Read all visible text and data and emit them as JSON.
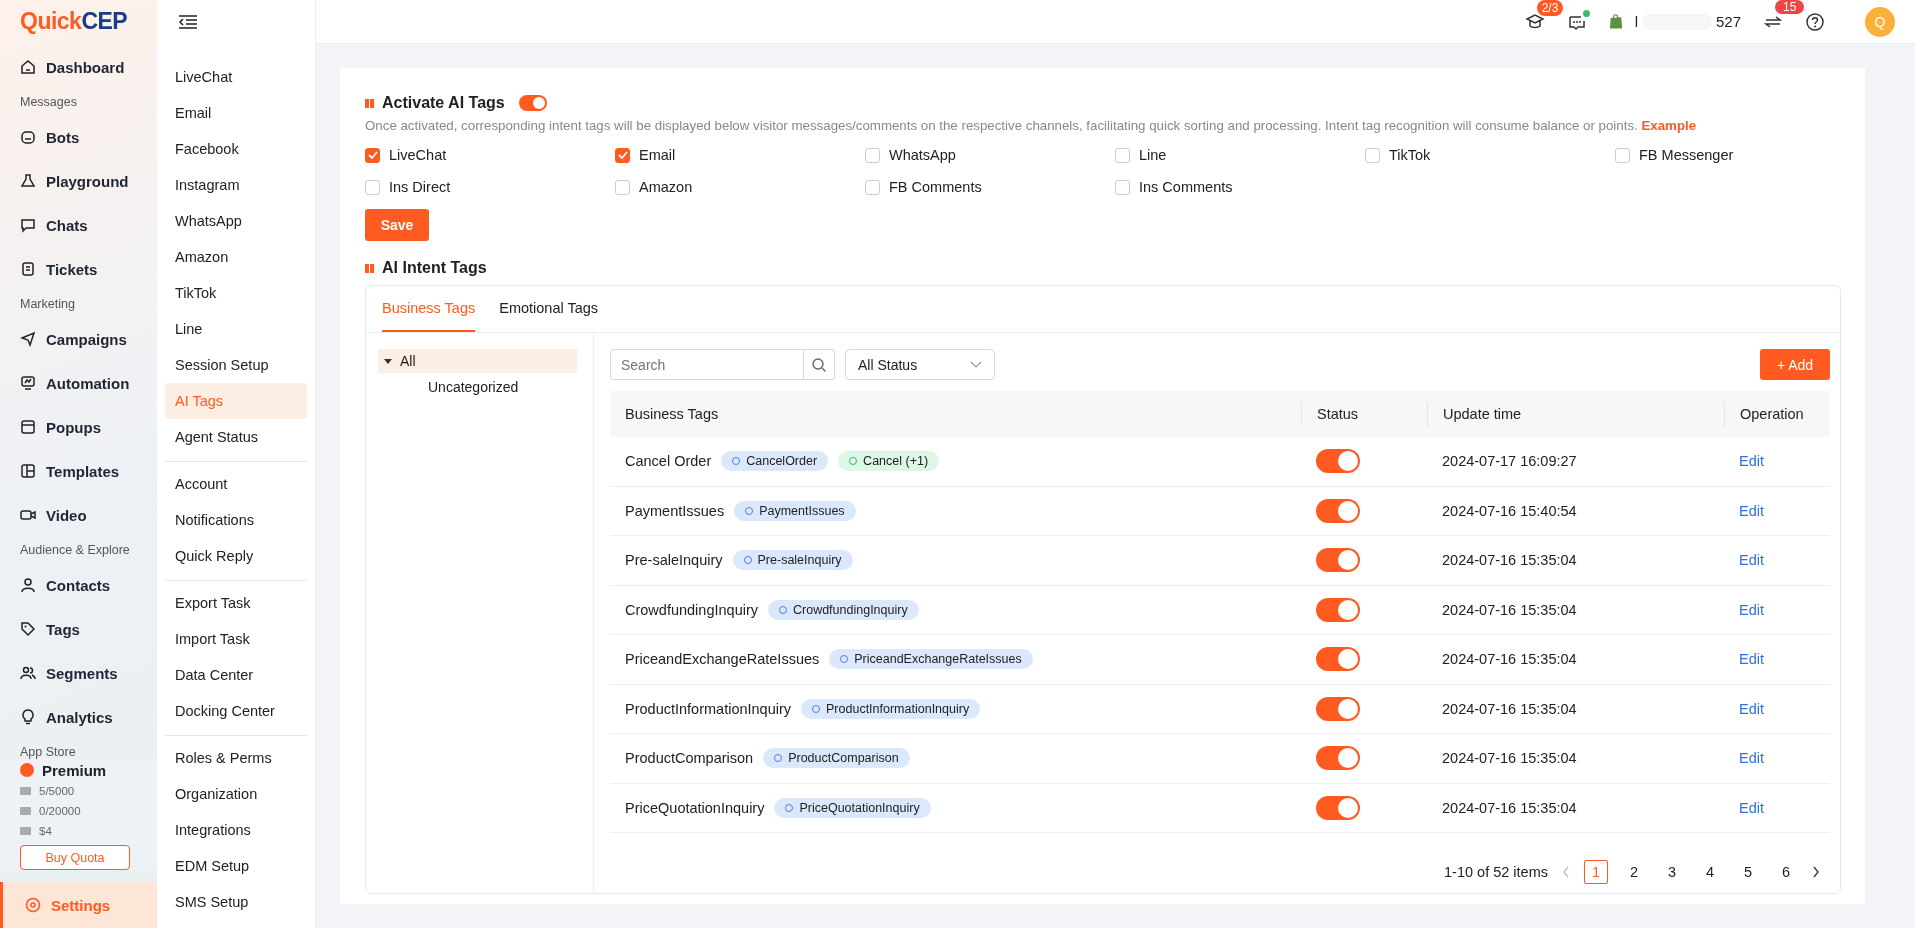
{
  "logo": {
    "text": "QuickCEP"
  },
  "nav": [
    {
      "kind": "item",
      "label": "Dashboard",
      "selected": false
    },
    {
      "kind": "header",
      "label": "Messages"
    },
    {
      "kind": "item",
      "label": "Bots",
      "selected": false
    },
    {
      "kind": "item",
      "label": "Playground",
      "selected": false
    },
    {
      "kind": "item",
      "label": "Chats",
      "selected": false
    },
    {
      "kind": "item",
      "label": "Tickets",
      "selected": false
    },
    {
      "kind": "header",
      "label": "Marketing"
    },
    {
      "kind": "item",
      "label": "Campaigns",
      "selected": false
    },
    {
      "kind": "item",
      "label": "Automation",
      "selected": false
    },
    {
      "kind": "item",
      "label": "Popups",
      "selected": false
    },
    {
      "kind": "item",
      "label": "Templates",
      "selected": false
    },
    {
      "kind": "item",
      "label": "Video",
      "selected": false
    },
    {
      "kind": "header",
      "label": "Audience & Explore"
    },
    {
      "kind": "item",
      "label": "Contacts",
      "selected": false
    },
    {
      "kind": "item",
      "label": "Tags",
      "selected": false
    },
    {
      "kind": "item",
      "label": "Segments",
      "selected": false
    },
    {
      "kind": "item",
      "label": "Analytics",
      "selected": false
    },
    {
      "kind": "header",
      "label": "App Store"
    }
  ],
  "plan": {
    "name": "Premium",
    "quotas": [
      "5/5000",
      "0/20000",
      "$4"
    ],
    "button": "Buy Quota"
  },
  "settings_item": {
    "label": "Settings",
    "selected": true
  },
  "settings_menu": [
    [
      {
        "label": "LiveChat",
        "selected": false
      },
      {
        "label": "Email",
        "selected": false
      },
      {
        "label": "Facebook",
        "selected": false
      },
      {
        "label": "Instagram",
        "selected": false
      },
      {
        "label": "WhatsApp",
        "selected": false
      },
      {
        "label": "Amazon",
        "selected": false
      },
      {
        "label": "TikTok",
        "selected": false
      },
      {
        "label": "Line",
        "selected": false
      },
      {
        "label": "Session Setup",
        "selected": false
      },
      {
        "label": "AI Tags",
        "selected": true
      },
      {
        "label": "Agent Status",
        "selected": false
      }
    ],
    [
      {
        "label": "Account",
        "selected": false
      },
      {
        "label": "Notifications",
        "selected": false
      },
      {
        "label": "Quick Reply",
        "selected": false
      }
    ],
    [
      {
        "label": "Export Task",
        "selected": false
      },
      {
        "label": "Import Task",
        "selected": false
      },
      {
        "label": "Data Center",
        "selected": false
      },
      {
        "label": "Docking Center",
        "selected": false
      }
    ],
    [
      {
        "label": "Roles & Perms",
        "selected": false
      },
      {
        "label": "Organization",
        "selected": false
      },
      {
        "label": "Integrations",
        "selected": false
      },
      {
        "label": "EDM Setup",
        "selected": false
      },
      {
        "label": "SMS Setup",
        "selected": false
      }
    ]
  ],
  "topbar": {
    "course_badge": "2/3",
    "chat_unread": true,
    "store_start": "l",
    "store_end": "527",
    "switch_badge": "15",
    "avatar": "Q"
  },
  "activate": {
    "title": "Activate AI Tags",
    "on": true,
    "description": "Once activated, corresponding intent tags will be displayed below visitor messages/comments on the respective channels, facilitating quick sorting and processing. Intent tag recognition will consume balance or points.",
    "link": "Example",
    "channels": [
      {
        "label": "LiveChat",
        "checked": true
      },
      {
        "label": "Email",
        "checked": true
      },
      {
        "label": "WhatsApp",
        "checked": false
      },
      {
        "label": "Line",
        "checked": false
      },
      {
        "label": "TikTok",
        "checked": false
      },
      {
        "label": "FB Messenger",
        "checked": false
      },
      {
        "label": "Ins Direct",
        "checked": false
      },
      {
        "label": "Amazon",
        "checked": false
      },
      {
        "label": "FB Comments",
        "checked": false
      },
      {
        "label": "Ins Comments",
        "checked": false
      }
    ],
    "save": "Save"
  },
  "intent": {
    "title": "AI Intent Tags",
    "tabs": [
      {
        "label": "Business Tags",
        "selected": true
      },
      {
        "label": "Emotional Tags",
        "selected": false
      }
    ],
    "tree": {
      "label": "All",
      "selected": true,
      "expanded": true,
      "children": [
        {
          "label": "Uncategorized",
          "selected": false
        }
      ]
    },
    "search": {
      "placeholder": "Search"
    },
    "status_filter": "All Status",
    "add": "+ Add",
    "table": {
      "columns": [
        "Business Tags",
        "Status",
        "Update time",
        "Operation"
      ],
      "rows": [
        {
          "name": "Cancel Order",
          "tags": [
            {
              "kind": "intent",
              "label": "CancelOrder"
            },
            {
              "kind": "emotion",
              "label": "Cancel (+1)"
            }
          ],
          "on": true,
          "time": "2024-07-17 16:09:27",
          "action": "Edit"
        },
        {
          "name": "PaymentIssues",
          "tags": [
            {
              "kind": "intent",
              "label": "PaymentIssues"
            }
          ],
          "on": true,
          "time": "2024-07-16 15:40:54",
          "action": "Edit"
        },
        {
          "name": "Pre-saleInquiry",
          "tags": [
            {
              "kind": "intent",
              "label": "Pre-saleInquiry"
            }
          ],
          "on": true,
          "time": "2024-07-16 15:35:04",
          "action": "Edit"
        },
        {
          "name": "CrowdfundingInquiry",
          "tags": [
            {
              "kind": "intent",
              "label": "CrowdfundingInquiry"
            }
          ],
          "on": true,
          "time": "2024-07-16 15:35:04",
          "action": "Edit"
        },
        {
          "name": "PriceandExchangeRateIssues",
          "tags": [
            {
              "kind": "intent",
              "label": "PriceandExchangeRateIssues"
            }
          ],
          "on": true,
          "time": "2024-07-16 15:35:04",
          "action": "Edit"
        },
        {
          "name": "ProductInformationInquiry",
          "tags": [
            {
              "kind": "intent",
              "label": "ProductInformationInquiry"
            }
          ],
          "on": true,
          "time": "2024-07-16 15:35:04",
          "action": "Edit"
        },
        {
          "name": "ProductComparison",
          "tags": [
            {
              "kind": "intent",
              "label": "ProductComparison"
            }
          ],
          "on": true,
          "time": "2024-07-16 15:35:04",
          "action": "Edit"
        },
        {
          "name": "PriceQuotationInquiry",
          "tags": [
            {
              "kind": "intent",
              "label": "PriceQuotationInquiry"
            }
          ],
          "on": true,
          "time": "2024-07-16 15:35:04",
          "action": "Edit"
        }
      ]
    },
    "pagination": {
      "summary": "1-10 of 52 items",
      "pages": [
        {
          "label": "1",
          "selected": true
        },
        {
          "label": "2",
          "selected": false
        },
        {
          "label": "3",
          "selected": false
        },
        {
          "label": "4",
          "selected": false
        },
        {
          "label": "5",
          "selected": false
        },
        {
          "label": "6",
          "selected": false
        }
      ]
    }
  }
}
